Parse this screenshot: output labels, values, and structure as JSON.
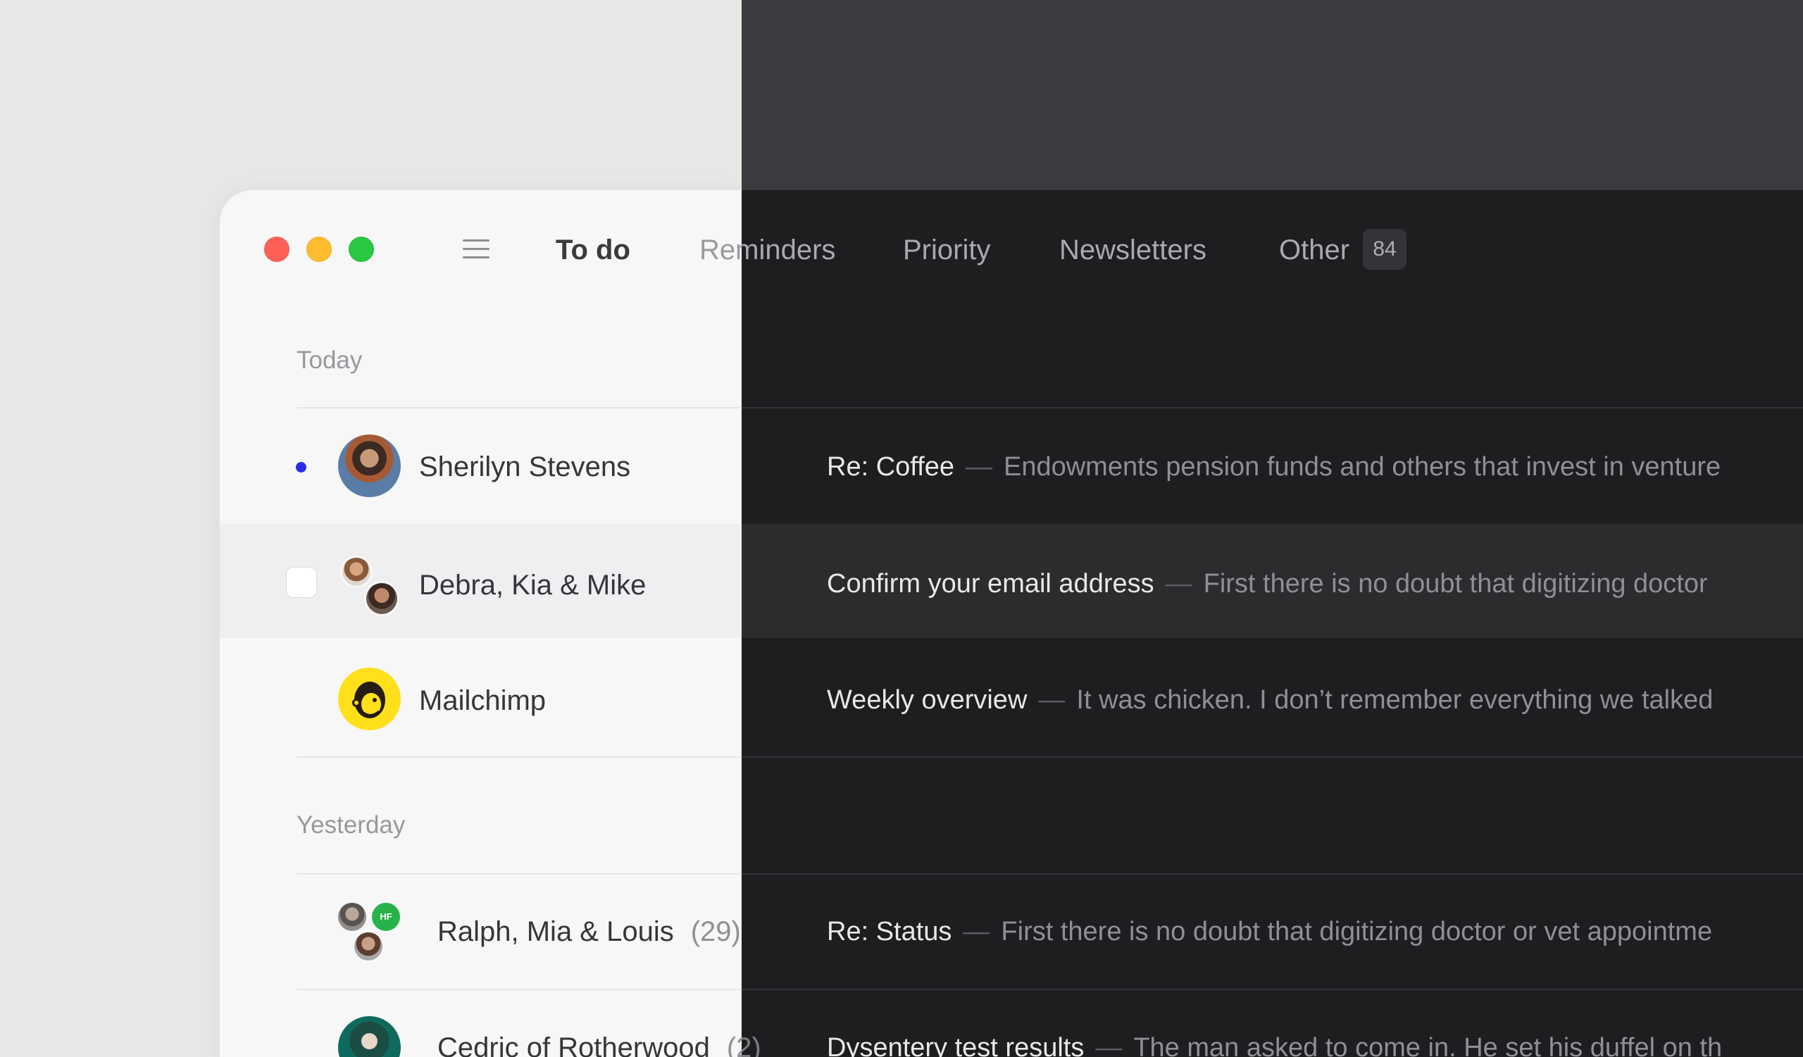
{
  "tabs": {
    "todo": "To do",
    "reminders": "Reminders",
    "priority": "Priority",
    "newsletters": "Newsletters",
    "other": "Other",
    "other_count": "84"
  },
  "sections": {
    "today": "Today",
    "yesterday": "Yesterday"
  },
  "threads": [
    {
      "sender": "Sherilyn Stevens",
      "count": "",
      "subject": "Re: Coffee",
      "separator": "—",
      "preview": "Endowments pension funds and others that invest in venture"
    },
    {
      "sender": "Debra, Kia & Mike",
      "count": "",
      "subject": "Confirm your email address",
      "separator": "—",
      "preview": "First there is no doubt that digitizing doctor"
    },
    {
      "sender": "Mailchimp",
      "count": "",
      "subject": "Weekly overview",
      "separator": "—",
      "preview": "It was chicken. I don’t remember everything we talked"
    },
    {
      "sender": "Ralph, Mia & Louis",
      "count": "(29)",
      "subject": "Re: Status",
      "separator": "—",
      "preview": "First there is no doubt that digitizing doctor or vet appointme"
    },
    {
      "sender": "Cedric of Rotherwood",
      "count": "(2)",
      "subject": "Dysentery test results",
      "separator": "—",
      "preview": "The man asked to come in. He set his duffel on th"
    }
  ],
  "avatars": {
    "group_initials": "HF"
  },
  "colors": {
    "unread": "#2a2ee8",
    "traffic_red": "#fe5f57",
    "traffic_yellow": "#febc2e",
    "traffic_green": "#28c840",
    "group_badge": "#27b24a",
    "mailchimp_yellow": "#ffe01b"
  }
}
